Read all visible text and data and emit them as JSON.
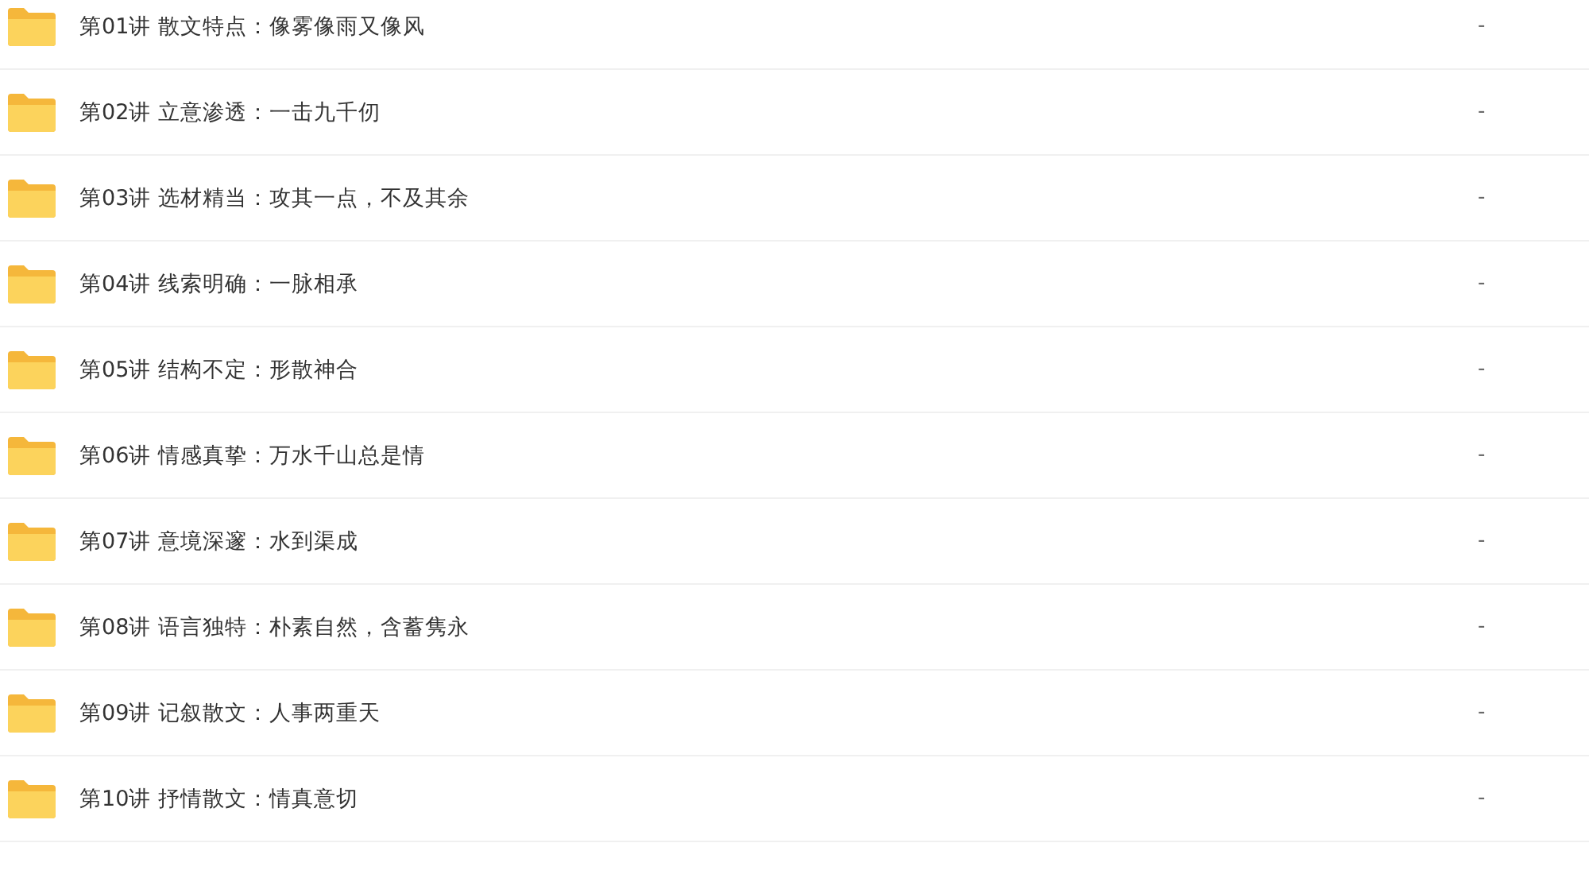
{
  "files": [
    {
      "name": "第01讲 散文特点：像雾像雨又像风",
      "size": "-"
    },
    {
      "name": "第02讲 立意渗透：一击九千仞",
      "size": "-"
    },
    {
      "name": "第03讲 选材精当：攻其一点，不及其余",
      "size": "-"
    },
    {
      "name": "第04讲 线索明确：一脉相承",
      "size": "-"
    },
    {
      "name": "第05讲 结构不定：形散神合",
      "size": "-"
    },
    {
      "name": "第06讲 情感真挚：万水千山总是情",
      "size": "-"
    },
    {
      "name": "第07讲 意境深邃：水到渠成",
      "size": "-"
    },
    {
      "name": "第08讲 语言独特：朴素自然，含蓄隽永",
      "size": "-"
    },
    {
      "name": "第09讲 记叙散文：人事两重天",
      "size": "-"
    },
    {
      "name": "第10讲 抒情散文：情真意切",
      "size": "-"
    }
  ]
}
